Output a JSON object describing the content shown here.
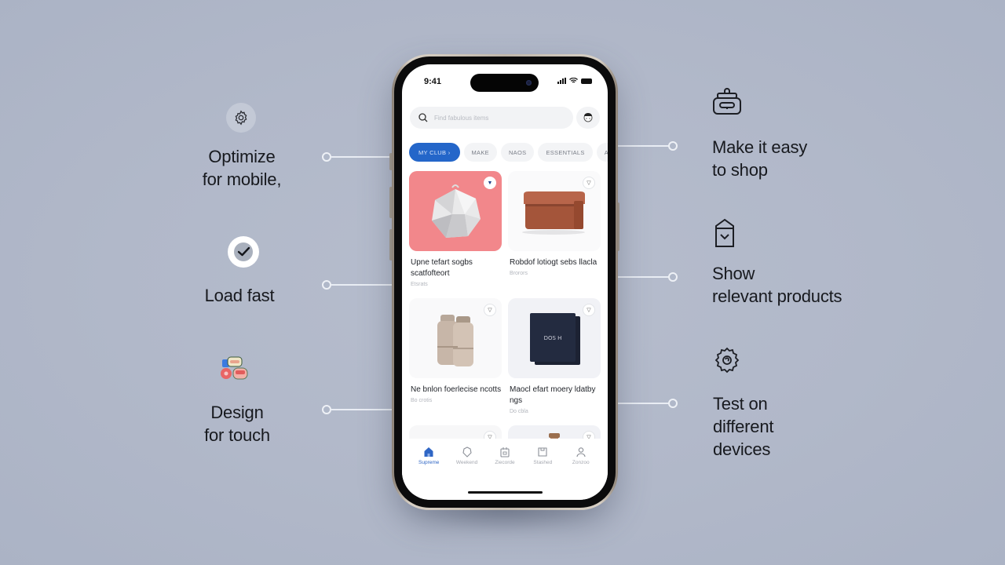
{
  "phone": {
    "status_time": "9:41",
    "search": {
      "placeholder": "Find fabulous items",
      "icon": "search-icon"
    },
    "profile_icon": "avatar-icon",
    "chips": [
      {
        "label": "MY CLUB ›",
        "active": true
      },
      {
        "label": "MAKE",
        "active": false
      },
      {
        "label": "NAOS",
        "active": false
      },
      {
        "label": "ESSENTIALS",
        "active": false
      },
      {
        "label": "ADBO",
        "active": false
      }
    ],
    "products": [
      {
        "title": "Upne tefart sogbs scatfofteort",
        "meta": "Etsrats",
        "image": "white-faceted-bag",
        "favorite": true
      },
      {
        "title": "Robdof lotiogt sebs llacla",
        "meta": "Brorors",
        "image": "brown-leather-box",
        "favorite": false
      },
      {
        "title": "Ne bnlon foerlecise ncotts",
        "meta": "Bo crotis",
        "image": "beige-bottles",
        "favorite": false
      },
      {
        "title": "Maocl efart moery ldatby ngs",
        "meta": "Do cbla",
        "image": "navy-gift-box",
        "favorite": false
      },
      {
        "title": "",
        "meta": "",
        "image": "red-berries",
        "favorite": false
      },
      {
        "title": "",
        "meta": "",
        "image": "wooden-bottle",
        "favorite": false
      }
    ],
    "tabbar": [
      {
        "label": "Supreme",
        "icon": "home-icon",
        "active": true
      },
      {
        "label": "Weekend",
        "icon": "bag-icon",
        "active": false
      },
      {
        "label": "Ziecorde",
        "icon": "calendar-icon",
        "active": false
      },
      {
        "label": "Stashed",
        "icon": "cart-icon",
        "active": false
      },
      {
        "label": "Zonzoo",
        "icon": "profile-icon",
        "active": false
      }
    ]
  },
  "callouts": {
    "left": [
      {
        "text_lines": [
          "Optimize",
          "for mobile,"
        ],
        "icon": "gear-icon"
      },
      {
        "text_lines": [
          "Load fast"
        ],
        "icon": "check-circle-icon"
      },
      {
        "text_lines": [
          "Design",
          "for touch"
        ],
        "icon": "touch-stickers-icon"
      }
    ],
    "right": [
      {
        "text_lines": [
          "Make it easy",
          "to shop"
        ],
        "icon": "shopping-basket-icon"
      },
      {
        "text_lines": [
          "Show",
          "relevant products"
        ],
        "icon": "product-tag-icon"
      },
      {
        "text_lines": [
          "Test on",
          "different",
          "devices"
        ],
        "icon": "settings-badge-icon"
      }
    ]
  },
  "colors": {
    "background": "#b0b8c9",
    "accent": "#2466c9",
    "product_pink": "#f2878b",
    "text": "#17191e"
  }
}
